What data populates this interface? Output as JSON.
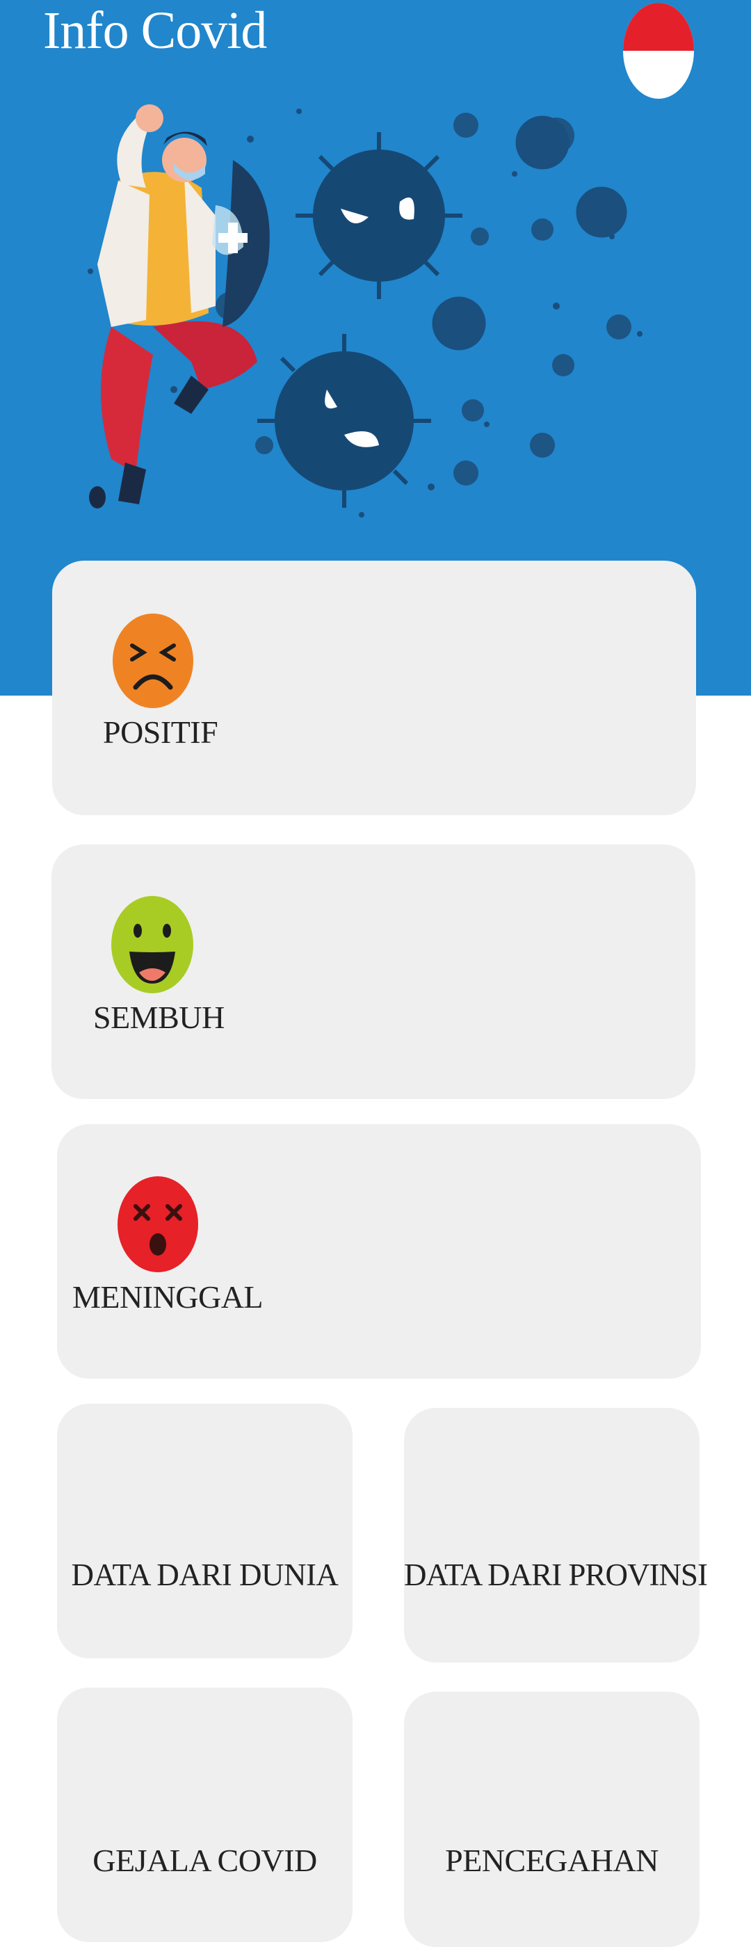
{
  "header": {
    "title": "Info Covid",
    "flag_icon": "indonesia-flag-icon",
    "background_color": "#2186cc"
  },
  "stats": {
    "positive": {
      "label": "POSITIF",
      "icon": "sad-face-icon",
      "color": "#ef8323"
    },
    "recovered": {
      "label": "SEMBUH",
      "icon": "happy-face-icon",
      "color": "#a8cc24"
    },
    "deaths": {
      "label": "MENINGGAL",
      "icon": "dead-face-icon",
      "color": "#e62127"
    }
  },
  "menu": {
    "world_data": "DATA DARI DUNIA",
    "province_data": "DATA DARI PROVINSI",
    "symptoms": "GEJALA COVID",
    "prevention": "PENCEGAHAN"
  }
}
